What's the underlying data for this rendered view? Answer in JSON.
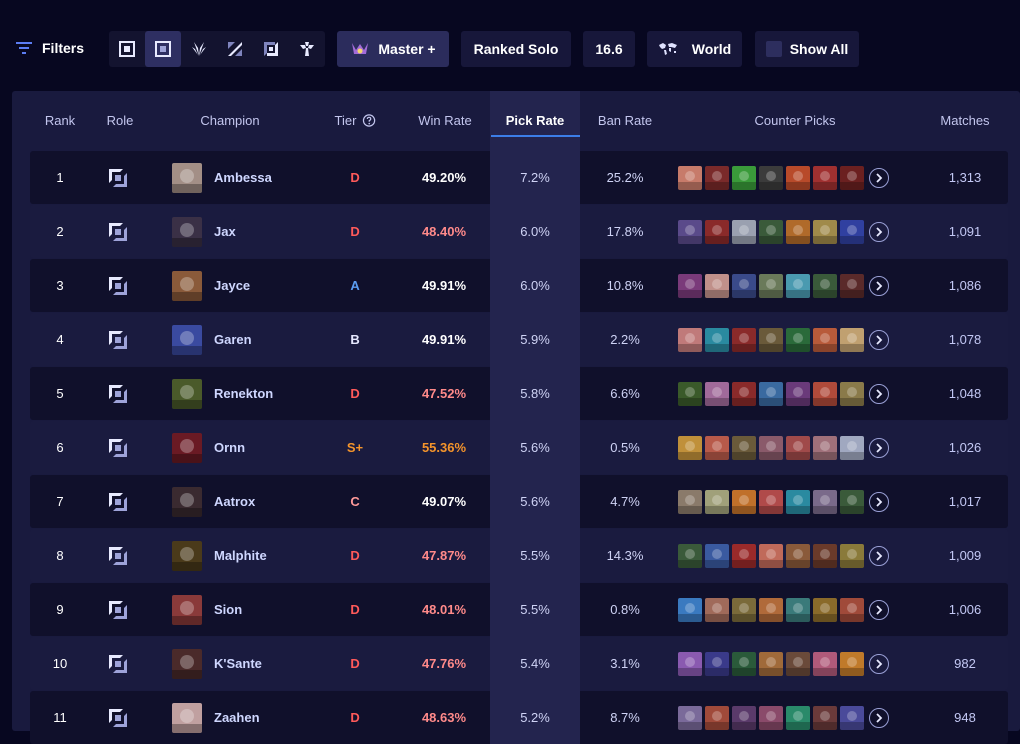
{
  "filters": {
    "label": "Filters",
    "roles": [
      "top-role-icon",
      "jungle-role-icon",
      "mid-role-icon",
      "bot-role-icon",
      "support-role-icon"
    ],
    "rank": "Master +",
    "queue": "Ranked Solo",
    "patch": "16.6",
    "region": "World",
    "show_all": "Show All"
  },
  "colors": {
    "tier_S_plus": "#f4942b",
    "tier_A": "#5b9cf2",
    "tier_B": "#e6e8ff",
    "tier_C": "#ff9a9a",
    "tier_D": "#ff5a5a",
    "winrate_high": "#f4942b",
    "winrate_mid": "#ffffff",
    "winrate_low": "#ff8a8a",
    "accent": "#3c7ee8"
  },
  "table": {
    "headers": {
      "rank": "Rank",
      "role": "Role",
      "champion": "Champion",
      "tier": "Tier",
      "win_rate": "Win Rate",
      "pick_rate": "Pick Rate",
      "ban_rate": "Ban Rate",
      "counter_picks": "Counter Picks",
      "matches": "Matches"
    },
    "sorted_by": "Pick Rate",
    "rows": [
      {
        "rank": "1",
        "champion": "Ambessa",
        "tier": "D",
        "win_rate": "49.20%",
        "pick_rate": "7.2%",
        "ban_rate": "25.2%",
        "matches": "1,313"
      },
      {
        "rank": "2",
        "champion": "Jax",
        "tier": "D",
        "win_rate": "48.40%",
        "pick_rate": "6.0%",
        "ban_rate": "17.8%",
        "matches": "1,091"
      },
      {
        "rank": "3",
        "champion": "Jayce",
        "tier": "A",
        "win_rate": "49.91%",
        "pick_rate": "6.0%",
        "ban_rate": "10.8%",
        "matches": "1,086"
      },
      {
        "rank": "4",
        "champion": "Garen",
        "tier": "B",
        "win_rate": "49.91%",
        "pick_rate": "5.9%",
        "ban_rate": "2.2%",
        "matches": "1,078"
      },
      {
        "rank": "5",
        "champion": "Renekton",
        "tier": "D",
        "win_rate": "47.52%",
        "pick_rate": "5.8%",
        "ban_rate": "6.6%",
        "matches": "1,048"
      },
      {
        "rank": "6",
        "champion": "Ornn",
        "tier": "S+",
        "win_rate": "55.36%",
        "pick_rate": "5.6%",
        "ban_rate": "0.5%",
        "matches": "1,026"
      },
      {
        "rank": "7",
        "champion": "Aatrox",
        "tier": "C",
        "win_rate": "49.07%",
        "pick_rate": "5.6%",
        "ban_rate": "4.7%",
        "matches": "1,017"
      },
      {
        "rank": "8",
        "champion": "Malphite",
        "tier": "D",
        "win_rate": "47.87%",
        "pick_rate": "5.5%",
        "ban_rate": "14.3%",
        "matches": "1,009"
      },
      {
        "rank": "9",
        "champion": "Sion",
        "tier": "D",
        "win_rate": "48.01%",
        "pick_rate": "5.5%",
        "ban_rate": "0.8%",
        "matches": "1,006"
      },
      {
        "rank": "10",
        "champion": "K'Sante",
        "tier": "D",
        "win_rate": "47.76%",
        "pick_rate": "5.4%",
        "ban_rate": "3.1%",
        "matches": "982"
      },
      {
        "rank": "11",
        "champion": "Zaahen",
        "tier": "D",
        "win_rate": "48.63%",
        "pick_rate": "5.2%",
        "ban_rate": "8.7%",
        "matches": "948"
      }
    ]
  }
}
